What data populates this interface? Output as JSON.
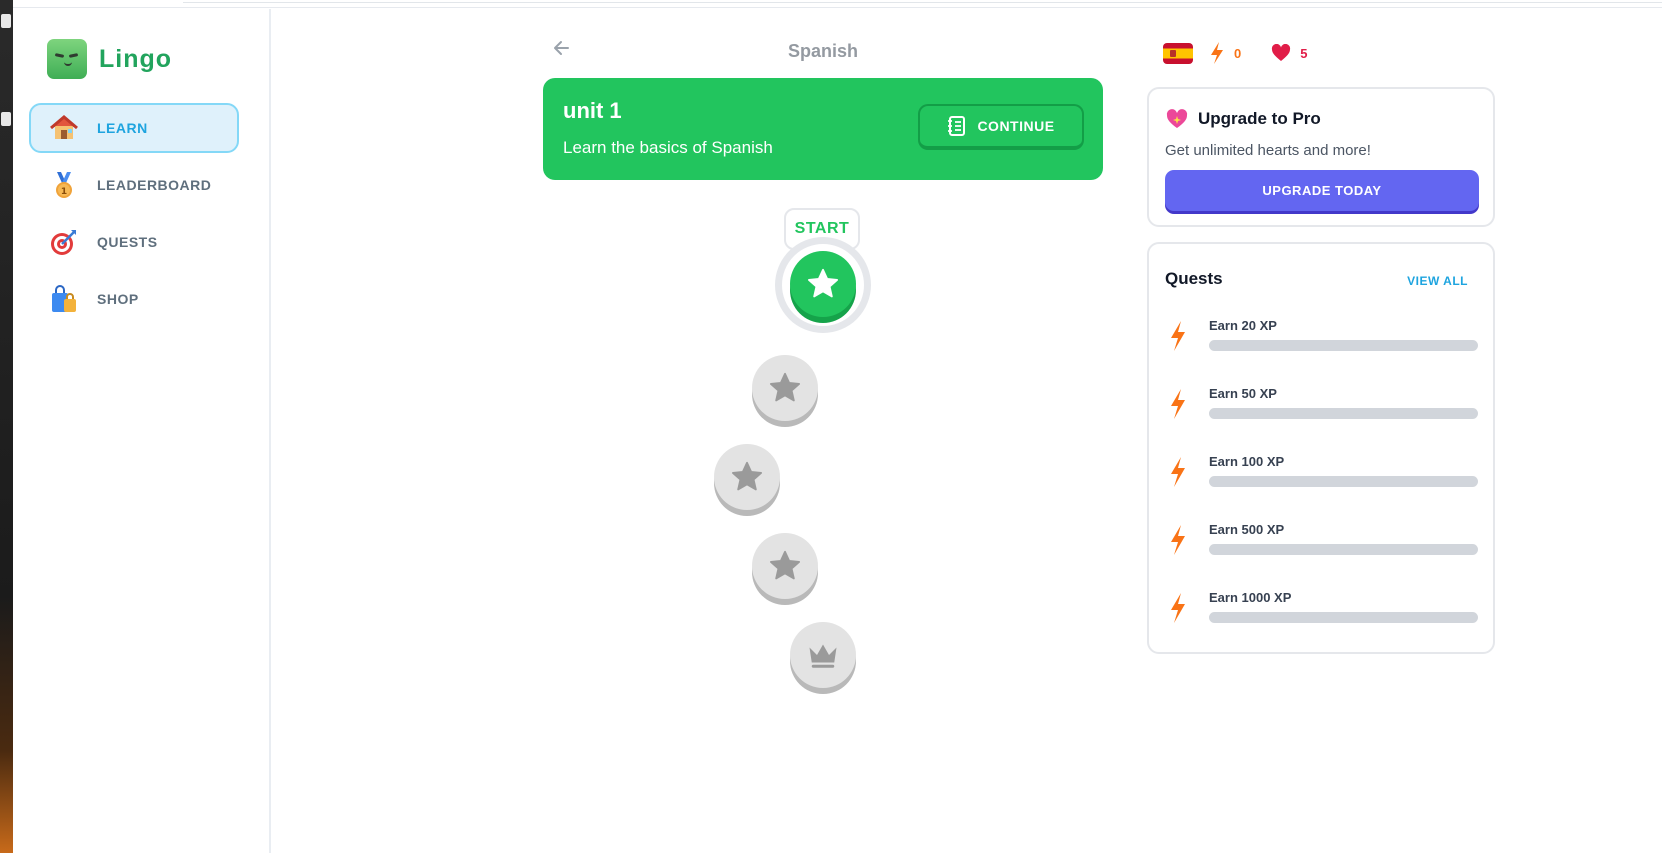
{
  "app": {
    "name": "Lingo"
  },
  "sidebar": {
    "items": [
      {
        "label": "LEARN",
        "icon": "house-icon",
        "active": true
      },
      {
        "label": "LEADERBOARD",
        "icon": "medal-icon",
        "active": false
      },
      {
        "label": "QUESTS",
        "icon": "target-icon",
        "active": false
      },
      {
        "label": "SHOP",
        "icon": "shopping-bag-icon",
        "active": false
      }
    ]
  },
  "header": {
    "title": "Spanish"
  },
  "unit": {
    "title": "unit 1",
    "description": "Learn the basics of Spanish",
    "continue_label": "CONTINUE"
  },
  "lessons": {
    "start_label": "START",
    "items": [
      {
        "status": "current",
        "icon": "star-icon"
      },
      {
        "status": "locked",
        "icon": "star-icon"
      },
      {
        "status": "locked",
        "icon": "star-icon"
      },
      {
        "status": "locked",
        "icon": "star-icon"
      },
      {
        "status": "locked",
        "icon": "crown-icon"
      }
    ]
  },
  "stats": {
    "course_flag": "spain-flag-icon",
    "points": "0",
    "hearts": "5"
  },
  "pro": {
    "title": "Upgrade to Pro",
    "subtitle": "Get unlimited hearts and more!",
    "button_label": "UPGRADE TODAY"
  },
  "quests": {
    "title": "Quests",
    "view_all_label": "VIEW ALL",
    "items": [
      {
        "label": "Earn 20 XP",
        "progress": 0
      },
      {
        "label": "Earn 50 XP",
        "progress": 0
      },
      {
        "label": "Earn 100 XP",
        "progress": 0
      },
      {
        "label": "Earn 500 XP",
        "progress": 0
      },
      {
        "label": "Earn 1000 XP",
        "progress": 0
      }
    ]
  },
  "colors": {
    "brand_green": "#22c55e",
    "accent_blue": "#1ea4df",
    "pro_purple": "#6366f1",
    "locked_gray": "#e3e3e3"
  }
}
